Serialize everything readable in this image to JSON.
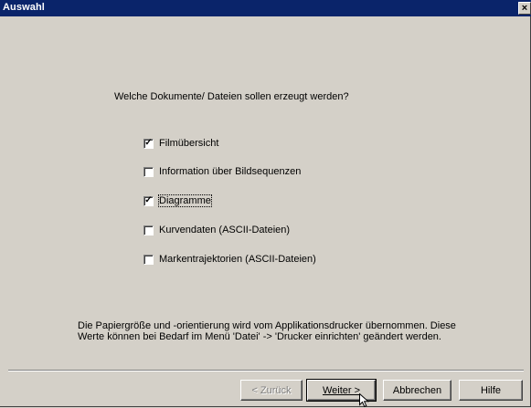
{
  "window": {
    "title": "Auswahl",
    "close_glyph": "×"
  },
  "question": "Welche Dokumente/ Dateien sollen erzeugt werden?",
  "options": [
    {
      "label": "Filmübersicht",
      "checked": true
    },
    {
      "label": "Information über Bildsequenzen",
      "checked": false
    },
    {
      "label": "Diagramme",
      "checked": true
    },
    {
      "label": "Kurvendaten (ASCII-Dateien)",
      "checked": false
    },
    {
      "label": "Markentrajektorien (ASCII-Dateien)",
      "checked": false
    }
  ],
  "info": {
    "line1": "Die Papiergröße und -orientierung wird vom Applikationsdrucker übernommen. Diese",
    "line2": "Werte können bei Bedarf im Menü 'Datei' -> 'Drucker einrichten' geändert werden."
  },
  "buttons": {
    "back": "< Zurück",
    "next": "Weiter >",
    "cancel": "Abbrechen",
    "help": "Hilfe"
  },
  "check_glyph": "✓",
  "colors": {
    "titlebar": "#0a246a",
    "face": "#d4d0c8"
  }
}
